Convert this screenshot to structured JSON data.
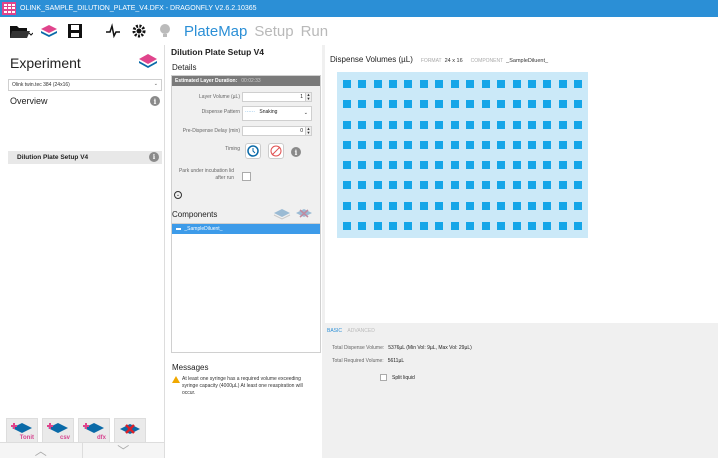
{
  "window": {
    "title": "OLINK_SAMPLE_DILUTION_PLATE_V4.DFX - DRAGONFLY V2.6.2.10365"
  },
  "nav": {
    "tabs": [
      {
        "label": "PlateMap",
        "active": true
      },
      {
        "label": "Setup",
        "active": false
      },
      {
        "label": "Run",
        "active": false
      }
    ]
  },
  "experiment": {
    "title": "Experiment",
    "selector": "Olink twin.tec 384 (24x16)",
    "overview": "Overview",
    "plate": "Dilution Plate Setup V4"
  },
  "bottom_icons": [
    "Tonit",
    "csv",
    "dfx"
  ],
  "setup": {
    "title": "Dilution Plate Setup V4",
    "details_label": "Details",
    "est_label": "Estimated Layer Duration:",
    "est_value": "00:02:33",
    "layer_volume_label": "Layer Volume (µL)",
    "layer_volume": "1",
    "dispense_pattern_label": "Dispense Pattern",
    "dispense_pattern": "Snaking",
    "pre_delay_label": "Pre-Dispense Delay (min)",
    "pre_delay": "0",
    "timing_label": "Timing",
    "park_label": "Park under incubation lid after run",
    "components_label": "Components",
    "component": "_SampleDiluent_",
    "messages_label": "Messages",
    "message": "At least one syringe has a required volume exceeding syringe capacity (4000µL) At least one reaspiration will occur."
  },
  "plate": {
    "title": "Dispense Volumes (µL)",
    "format_label": "FORMAT",
    "format_value": "24 x 16",
    "component_label": "COMPONENT",
    "component_value": "_SampleDiluent_",
    "columns": 16,
    "rows": 8,
    "fill_color": "#15a6e8",
    "bg_color": "#cbe9f8"
  },
  "bottom": {
    "tab_basic": "BASIC",
    "tab_advanced": "ADVANCED",
    "total_dispense_label": "Total Dispense Volume:",
    "total_dispense_value": "5376µL  (Min Vol: 9µL, Max Vol: 29µL)",
    "total_required_label": "Total Required Volume:",
    "total_required_value": "5611µL",
    "split_liquid": "Split liquid"
  },
  "colors": {
    "accent": "#2b8fd6",
    "titlebar": "#2b8fd6",
    "component_row": "#3d9be9"
  }
}
